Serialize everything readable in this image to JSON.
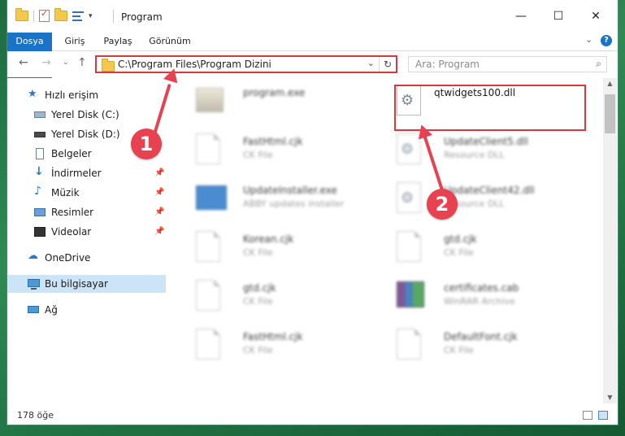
{
  "window": {
    "title": "Program"
  },
  "ribbon": {
    "tabs": [
      {
        "label": "Dosya"
      },
      {
        "label": "Giriş"
      },
      {
        "label": "Paylaş"
      },
      {
        "label": "Görünüm"
      }
    ]
  },
  "address": {
    "path": "C:\\Program Files\\Program Dizini"
  },
  "search": {
    "placeholder": "Ara: Program"
  },
  "sidebar": {
    "items": [
      {
        "label": "Hızlı erişim"
      },
      {
        "label": "Yerel Disk (C:)"
      },
      {
        "label": "Yerel Disk (D:)"
      },
      {
        "label": "Belgeler"
      },
      {
        "label": "İndirmeler"
      },
      {
        "label": "Müzik"
      },
      {
        "label": "Resimler"
      },
      {
        "label": "Videolar"
      },
      {
        "label": "OneDrive"
      },
      {
        "label": "Bu bilgisayar"
      },
      {
        "label": "Ağ"
      }
    ]
  },
  "files": [
    {
      "name": "program.exe",
      "type": ""
    },
    {
      "name": "qtwidgets100.dll",
      "type": ""
    },
    {
      "name": "FastHtml.cjk",
      "type": "CK File"
    },
    {
      "name": "UpdateClient5.dll",
      "type": "Resource DLL"
    },
    {
      "name": "UpdateInstaller.exe",
      "type": "ABBY updates installer"
    },
    {
      "name": "UpdateClient42.dll",
      "type": "Resource DLL"
    },
    {
      "name": "Korean.cjk",
      "type": "CK File"
    },
    {
      "name": "gtd.cjk",
      "type": "CK File"
    },
    {
      "name": "gtd.cjk",
      "type": "CK File"
    },
    {
      "name": "certificates.cab",
      "type": "WinRAR Archive"
    },
    {
      "name": "FastHtml.cjk",
      "type": "CK File"
    },
    {
      "name": "DefaultFont.cjk",
      "type": "CK File"
    }
  ],
  "status": {
    "count": "178 öğe"
  },
  "callouts": [
    {
      "number": "1"
    },
    {
      "number": "2"
    }
  ],
  "colors": {
    "accent": "#1a73c8",
    "highlight": "#d9383f",
    "callout": "#e8414f",
    "selection": "#cce4f7"
  }
}
